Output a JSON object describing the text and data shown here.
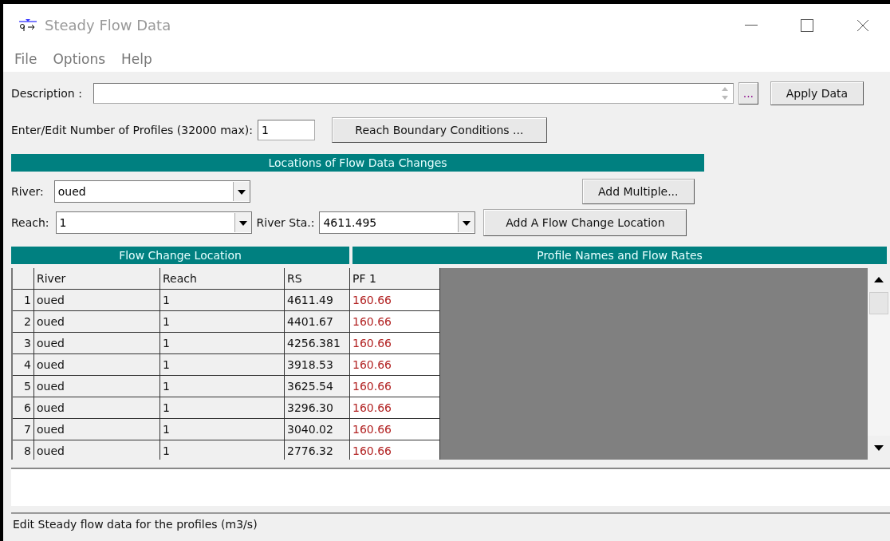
{
  "window": {
    "title": "Steady Flow Data"
  },
  "menu": [
    {
      "label": "File"
    },
    {
      "label": "Options"
    },
    {
      "label": "Help"
    }
  ],
  "description": {
    "label": "Description :",
    "more_button": "...",
    "apply_button": "Apply Data"
  },
  "profiles": {
    "label": "Enter/Edit Number of Profiles (32000 max):",
    "value": "1",
    "boundary_button": "Reach Boundary Conditions ..."
  },
  "locations": {
    "title": "Locations of Flow Data Changes",
    "river": {
      "label": "River:",
      "value": "oued"
    },
    "reach": {
      "label": "Reach:",
      "value": "1"
    },
    "river_sta": {
      "label": "River Sta.:",
      "value": "4611.495"
    },
    "add_multiple_button": "Add Multiple...",
    "add_location_button": "Add A Flow Change Location"
  },
  "table": {
    "group_headers": [
      "Flow Change Location",
      "Profile Names and Flow Rates"
    ],
    "columns": [
      "River",
      "Reach",
      "RS",
      "PF 1"
    ],
    "rows": [
      {
        "index": "1",
        "river": "oued",
        "reach": "1",
        "rs": "4611.49",
        "flow": "160.66"
      },
      {
        "index": "2",
        "river": "oued",
        "reach": "1",
        "rs": "4401.67",
        "flow": "160.66"
      },
      {
        "index": "3",
        "river": "oued",
        "reach": "1",
        "rs": "4256.381",
        "flow": "160.66"
      },
      {
        "index": "4",
        "river": "oued",
        "reach": "1",
        "rs": "3918.53",
        "flow": "160.66"
      },
      {
        "index": "5",
        "river": "oued",
        "reach": "1",
        "rs": "3625.54",
        "flow": "160.66"
      },
      {
        "index": "6",
        "river": "oued",
        "reach": "1",
        "rs": "3296.30",
        "flow": "160.66"
      },
      {
        "index": "7",
        "river": "oued",
        "reach": "1",
        "rs": "3040.02",
        "flow": "160.66"
      },
      {
        "index": "8",
        "river": "oued",
        "reach": "1",
        "rs": "2776.32",
        "flow": "160.66"
      }
    ]
  },
  "status_bar": "Edit Steady flow data for the profiles (m3/s)"
}
